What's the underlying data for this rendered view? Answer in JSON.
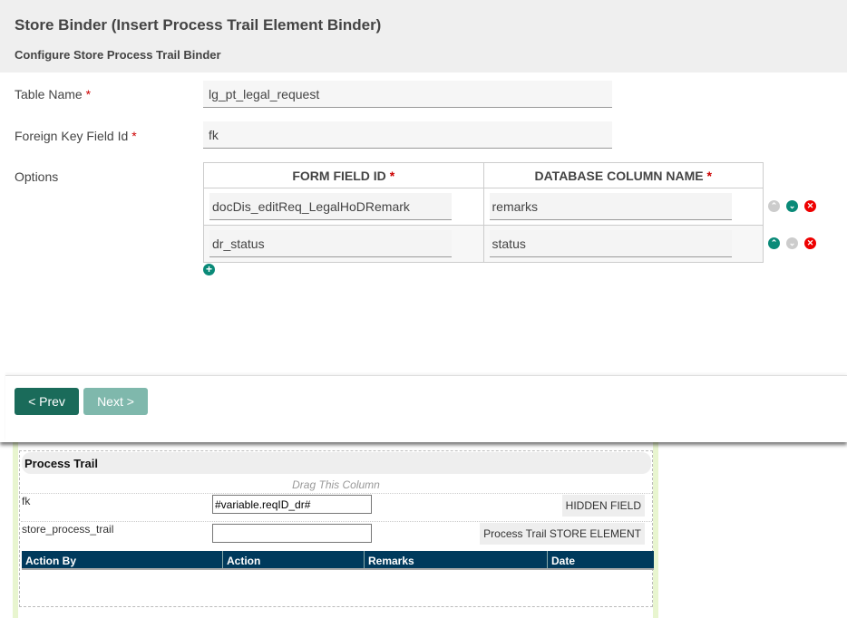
{
  "modal": {
    "title": "Store Binder (Insert Process Trail Element Binder)",
    "subtitle": "Configure Store Process Trail Binder",
    "fields": [
      {
        "label": "Table Name",
        "required": "*",
        "value": "lg_pt_legal_request"
      },
      {
        "label": "Foreign Key Field Id",
        "required": "*",
        "value": "fk"
      }
    ],
    "options_label": "Options",
    "table": {
      "headers": [
        "FORM FIELD ID",
        "DATABASE COLUMN NAME"
      ],
      "required": "*",
      "rows": [
        [
          "docDis_editReq_LegalHoDRemark",
          "remarks"
        ],
        [
          "dr_status",
          "status"
        ]
      ]
    },
    "prev": "< Prev",
    "next": "Next >"
  },
  "form": {
    "section": "Process Trail",
    "drag": "Drag This Column",
    "rows": [
      {
        "label": "fk",
        "value": "#variable.reqID_dr#",
        "tag": "HIDDEN FIELD"
      },
      {
        "label": "store_process_trail",
        "value": "",
        "tag": "Process Trail STORE ELEMENT"
      }
    ],
    "grid_headers": [
      "Action By",
      "Action",
      "Remarks",
      "Date"
    ]
  },
  "colors": {
    "primary": "#1a6b5a",
    "disabled": "#7fb8ac",
    "grid": "#003a5c",
    "delete": "#e00"
  }
}
